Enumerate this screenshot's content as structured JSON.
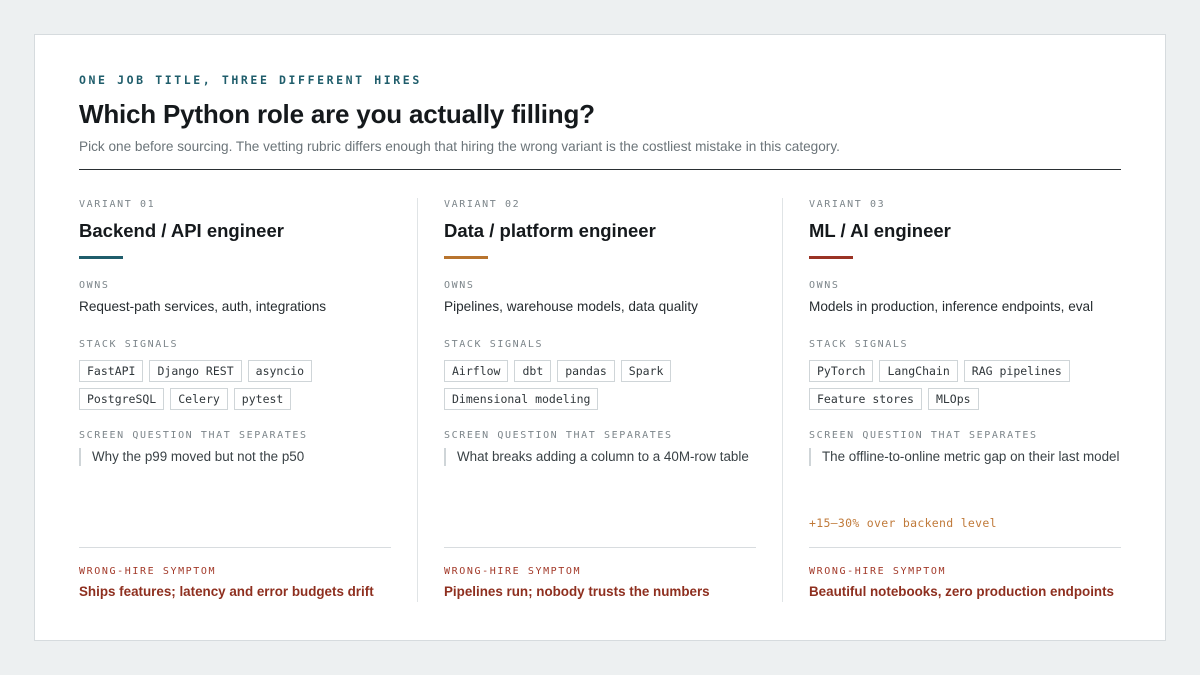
{
  "header": {
    "eyebrow": "ONE JOB TITLE, THREE DIFFERENT HIRES",
    "title": "Which Python role are you actually filling?",
    "subtitle": "Pick one before sourcing. The vetting rubric differs enough that hiring the wrong variant is the costliest mistake in this category."
  },
  "labels": {
    "owns": "OWNS",
    "stack": "STACK SIGNALS",
    "screen": "SCREEN QUESTION THAT SEPARATES",
    "wrong": "WRONG-HIRE SYMPTOM"
  },
  "variants": [
    {
      "kicker": "VARIANT 01",
      "name": "Backend / API engineer",
      "accent_color": "#1f5d6b",
      "owns": "Request-path services, auth, integrations",
      "tags": [
        "FastAPI",
        "Django REST",
        "asyncio",
        "PostgreSQL",
        "Celery",
        "pytest"
      ],
      "question": "Why the p99 moved but not the p50",
      "premium": "",
      "wrong": "Ships features; latency and error budgets drift"
    },
    {
      "kicker": "VARIANT 02",
      "name": "Data / platform engineer",
      "accent_color": "#b8742e",
      "owns": "Pipelines, warehouse models, data quality",
      "tags": [
        "Airflow",
        "dbt",
        "pandas",
        "Spark",
        "Dimensional modeling"
      ],
      "question": "What breaks adding a column to a 40M-row table",
      "premium": "",
      "wrong": "Pipelines run; nobody trusts the numbers"
    },
    {
      "kicker": "VARIANT 03",
      "name": "ML / AI engineer",
      "accent_color": "#9a3324",
      "owns": "Models in production, inference endpoints, eval",
      "tags": [
        "PyTorch",
        "LangChain",
        "RAG pipelines",
        "Feature stores",
        "MLOps"
      ],
      "question": "The offline-to-online metric gap on their last model",
      "premium": "+15–30% over backend level",
      "wrong": "Beautiful notebooks, zero production endpoints"
    }
  ]
}
